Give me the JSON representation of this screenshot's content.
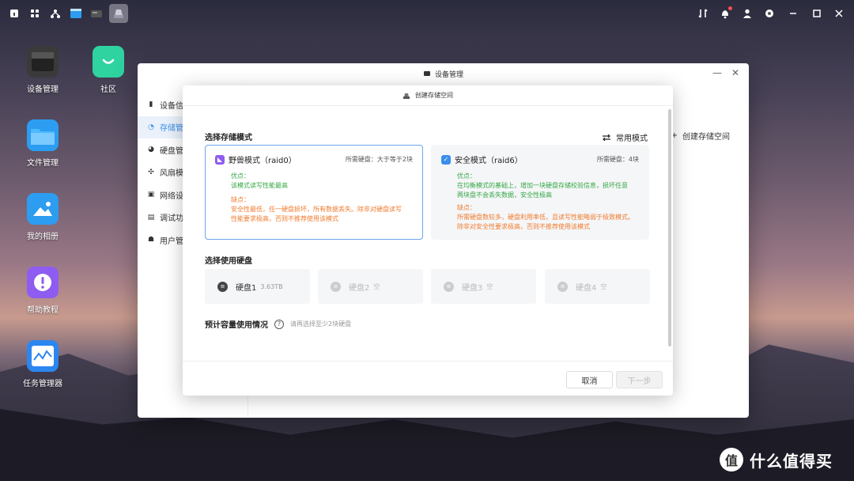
{
  "taskbar": {
    "left_icons": [
      "home-icon",
      "apps-grid-icon",
      "network-icon",
      "file-window-icon",
      "device-icon",
      "storage-app-icon"
    ],
    "right_icons": [
      "transfer-icon",
      "notification-icon",
      "user-icon",
      "settings-icon"
    ]
  },
  "desktop": {
    "items": [
      {
        "label": "设备管理",
        "icon": "device-manager-icon",
        "color": "#3a3a3a"
      },
      {
        "label": "社区",
        "icon": "community-icon",
        "color": "#2ed3a0"
      },
      {
        "label": "文件管理",
        "icon": "folder-icon",
        "color": "#2c9df0"
      },
      {
        "label": "我的相册",
        "icon": "photo-album-icon",
        "color": "#2c9df0"
      },
      {
        "label": "帮助教程",
        "icon": "help-icon",
        "color": "#8e5cf0"
      },
      {
        "label": "任务管理器",
        "icon": "task-manager-icon",
        "color": "#2c86f0"
      }
    ]
  },
  "window": {
    "title": "设备管理",
    "sidebar": [
      {
        "label": "设备信",
        "icon": "info-icon"
      },
      {
        "label": "存储管",
        "icon": "storage-icon",
        "active": true
      },
      {
        "label": "硬盘管",
        "icon": "disk-icon"
      },
      {
        "label": "风扇模",
        "icon": "fan-icon"
      },
      {
        "label": "网络设",
        "icon": "network-settings-icon"
      },
      {
        "label": "调试功",
        "icon": "debug-icon"
      },
      {
        "label": "用户管",
        "icon": "users-icon"
      }
    ],
    "create_space_label": "创建存储空间"
  },
  "modal": {
    "title": "创建存储空间",
    "section_mode": "选择存储模式",
    "common_mode_label": "常用模式",
    "modes": [
      {
        "name": "野兽模式（raid0）",
        "requirement": "所需硬盘：大于等于2块",
        "pros_title": "优点：",
        "pros": [
          "该模式读写性能最高"
        ],
        "cons_title": "缺点：",
        "cons": [
          "安全性最低，任一硬盘损坏，所有数据丢失。除非对硬盘读写",
          "性能要求极高，否则不推荐使用该模式"
        ],
        "icon_color": "#8e5cf0",
        "selected": true
      },
      {
        "name": "安全模式（raid6）",
        "requirement": "所需硬盘：4块",
        "pros_title": "优点：",
        "pros": [
          "在均衡模式的基础上，增加一块硬盘存储校验信息，损坏任意",
          "两块盘不会丢失数据，安全性极高"
        ],
        "cons_title": "缺点：",
        "cons": [
          "所需硬盘数较多，硬盘利用率低，且读写性能略弱于极致模式。",
          "除非对安全性要求极高，否则不推荐使用该模式"
        ],
        "icon_color": "#3b8fea",
        "selected": false
      }
    ],
    "section_disks": "选择使用硬盘",
    "disks": [
      {
        "name": "硬盘1",
        "capacity": "3.63TB",
        "enabled": true
      },
      {
        "name": "硬盘2",
        "capacity": "空",
        "enabled": false
      },
      {
        "name": "硬盘3",
        "capacity": "空",
        "enabled": false
      },
      {
        "name": "硬盘4",
        "capacity": "空",
        "enabled": false
      }
    ],
    "estimate_title": "预计容量使用情况",
    "estimate_hint": "请再选择至少2块硬盘",
    "cancel_label": "取消",
    "next_label": "下一步"
  },
  "watermark": {
    "logo": "值",
    "text": "什么值得买"
  }
}
